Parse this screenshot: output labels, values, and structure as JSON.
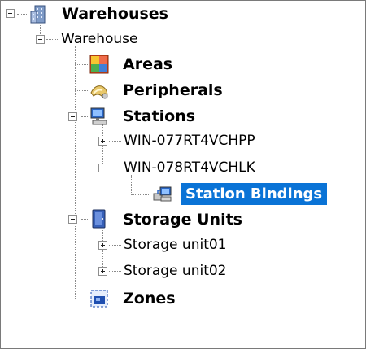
{
  "tree": {
    "root": {
      "label": "Warehouses",
      "icon": "building-icon",
      "expanded": true
    },
    "warehouse": {
      "label": "Warehouse",
      "expanded": true
    },
    "areas": {
      "label": "Areas",
      "icon": "areas-icon"
    },
    "peripherals": {
      "label": "Peripherals",
      "icon": "peripherals-icon"
    },
    "stations": {
      "label": "Stations",
      "icon": "station-computer-icon",
      "expanded": true
    },
    "station1": {
      "label": "WIN-077RT4VCHPP",
      "expanded": false
    },
    "station2": {
      "label": "WIN-078RT4VCHLK",
      "expanded": true
    },
    "station_bindings": {
      "label": "Station Bindings",
      "icon": "station-bindings-icon",
      "selected": true
    },
    "storage_units": {
      "label": "Storage Units",
      "icon": "storage-cabinet-icon",
      "expanded": true
    },
    "storage1": {
      "label": "Storage unit01",
      "expanded": false
    },
    "storage2": {
      "label": "Storage unit02",
      "expanded": false
    },
    "zones": {
      "label": "Zones",
      "icon": "zones-icon"
    }
  },
  "colors": {
    "selection": "#0a73d6",
    "connector": "#8a8a8a"
  }
}
